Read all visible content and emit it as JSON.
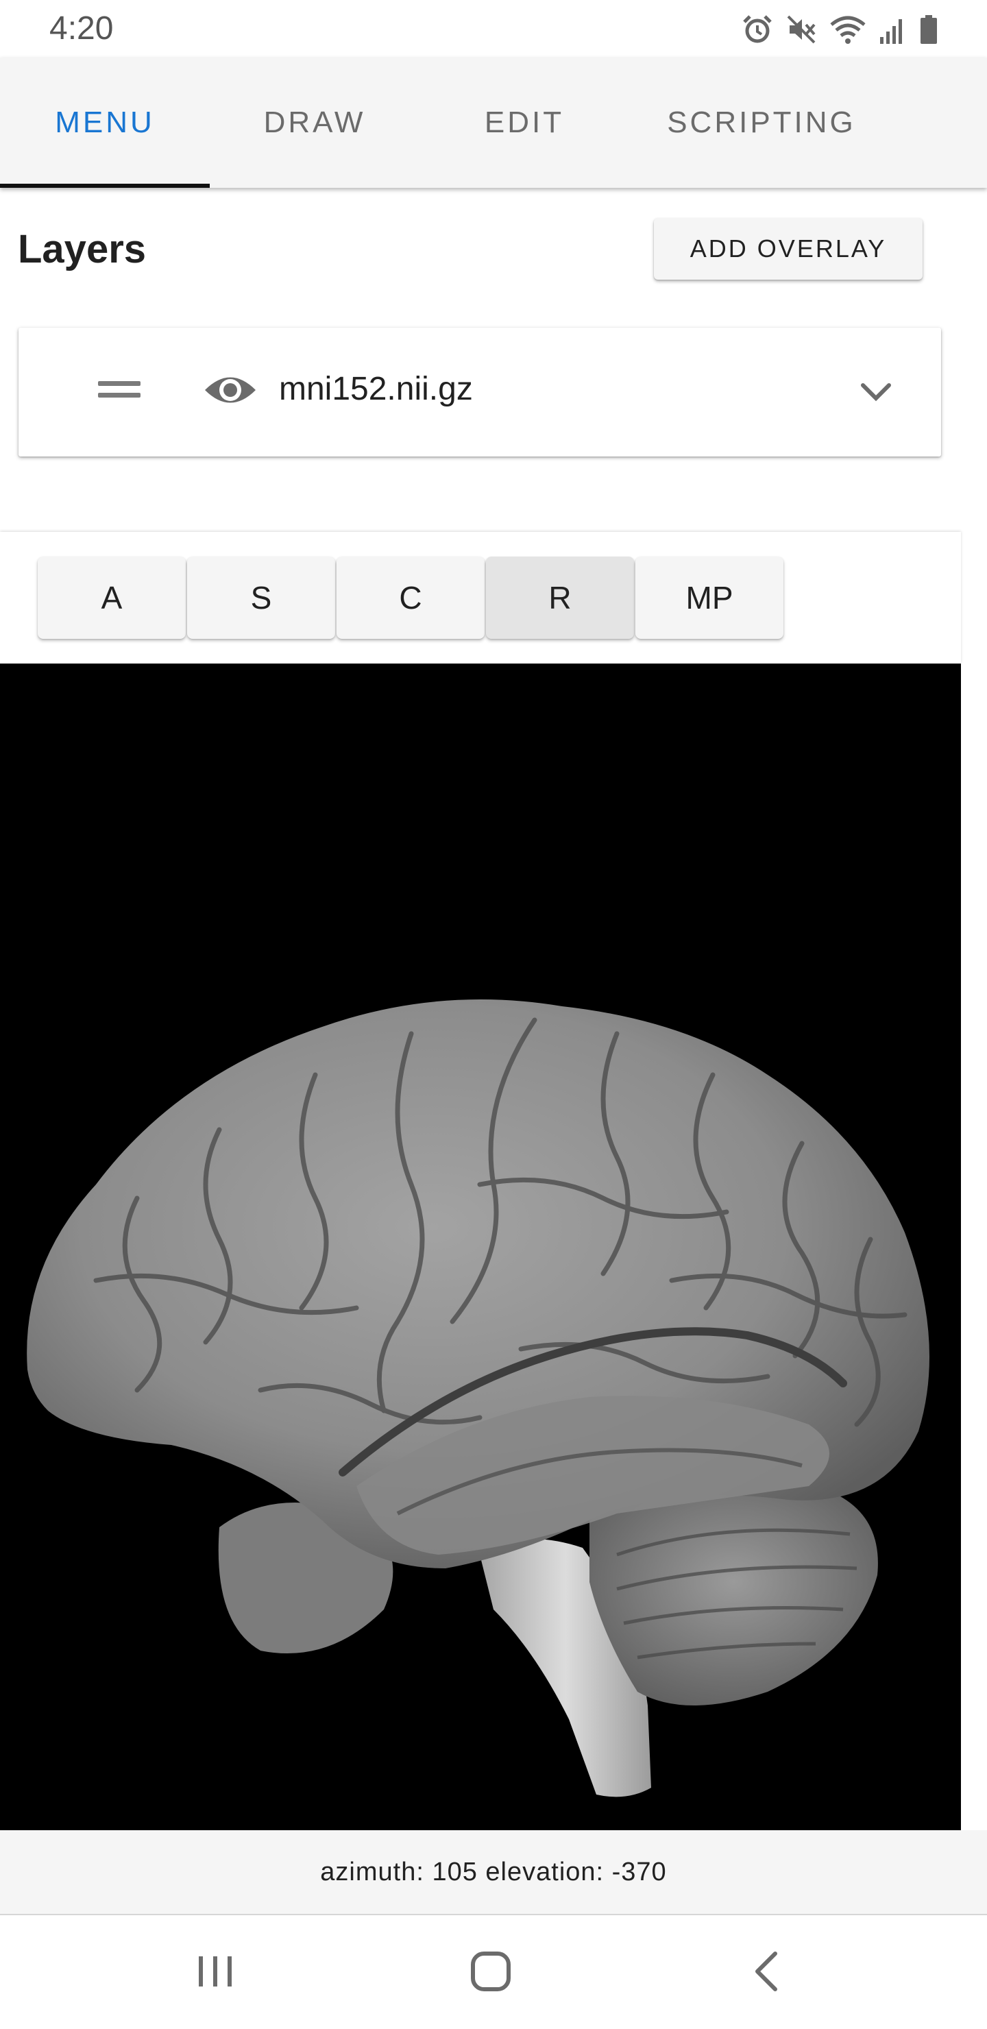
{
  "status_bar": {
    "time": "4:20",
    "icons": [
      "alarm-icon",
      "mute-icon",
      "wifi-icon",
      "signal-icon",
      "battery-icon"
    ]
  },
  "tabs": [
    {
      "label": "MENU",
      "active": true
    },
    {
      "label": "DRAW",
      "active": false
    },
    {
      "label": "EDIT",
      "active": false
    },
    {
      "label": "SCRIPTING",
      "active": false
    }
  ],
  "layers": {
    "title": "Layers",
    "add_overlay_label": "ADD OVERLAY",
    "items": [
      {
        "name": "mni152.nii.gz",
        "visible": true,
        "handle_icon": "drag-handle-icon",
        "visibility_icon": "eye-icon",
        "expand_icon": "chevron-down-icon"
      }
    ]
  },
  "view_buttons": [
    {
      "label": "A",
      "selected": false
    },
    {
      "label": "S",
      "selected": false
    },
    {
      "label": "C",
      "selected": false
    },
    {
      "label": "R",
      "selected": true
    },
    {
      "label": "MP",
      "selected": false
    }
  ],
  "viewer": {
    "status_text": "azimuth: 105 elevation: -370"
  },
  "nav_bar": {
    "icons": [
      "recent-apps-icon",
      "home-icon",
      "back-icon"
    ]
  },
  "colors": {
    "accent": "#1976d2",
    "tab_bar_bg": "#f5f5f5",
    "canvas_bg": "#000000",
    "indicator": "#111111"
  }
}
